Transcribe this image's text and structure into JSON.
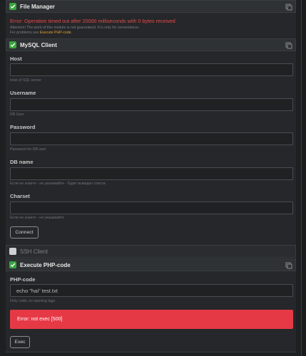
{
  "file_manager": {
    "title": "File Manager",
    "error": "Error: Operation timed out after 20000 milliseconds with 0 bytes received",
    "note_line1": "Attention! The work of this module is not guaranteed. It is only for convenience.",
    "note_line2_prefix": "For problems use",
    "note_link": "Execute PHP-code",
    "note_line2_suffix": "."
  },
  "mysql": {
    "title": "MySQL Client",
    "fields": [
      {
        "label": "Host",
        "value": "",
        "hint": "Host of SQL server"
      },
      {
        "label": "Username",
        "value": "",
        "hint": "DB User"
      },
      {
        "label": "Password",
        "value": "",
        "hint": "Password for DB user"
      },
      {
        "label": "DB name",
        "value": "",
        "hint": "Если не знаете - не указывайте - будет выведен список"
      },
      {
        "label": "Charset",
        "value": "",
        "hint": "Если не знаете - не указывайте"
      }
    ],
    "connect_label": "Connect"
  },
  "ssh": {
    "title": "SSH Client"
  },
  "php": {
    "title": "Execute PHP-code",
    "label": "PHP-code",
    "value": "echo \"hai\" test.txt",
    "hint": "Only code, no opening tags",
    "alert": "Error: not exec [500]",
    "exec_label": "Exec"
  },
  "colors": {
    "accent_green": "#38a53d",
    "error_red": "#e63946",
    "link_orange": "#e0a02b"
  }
}
